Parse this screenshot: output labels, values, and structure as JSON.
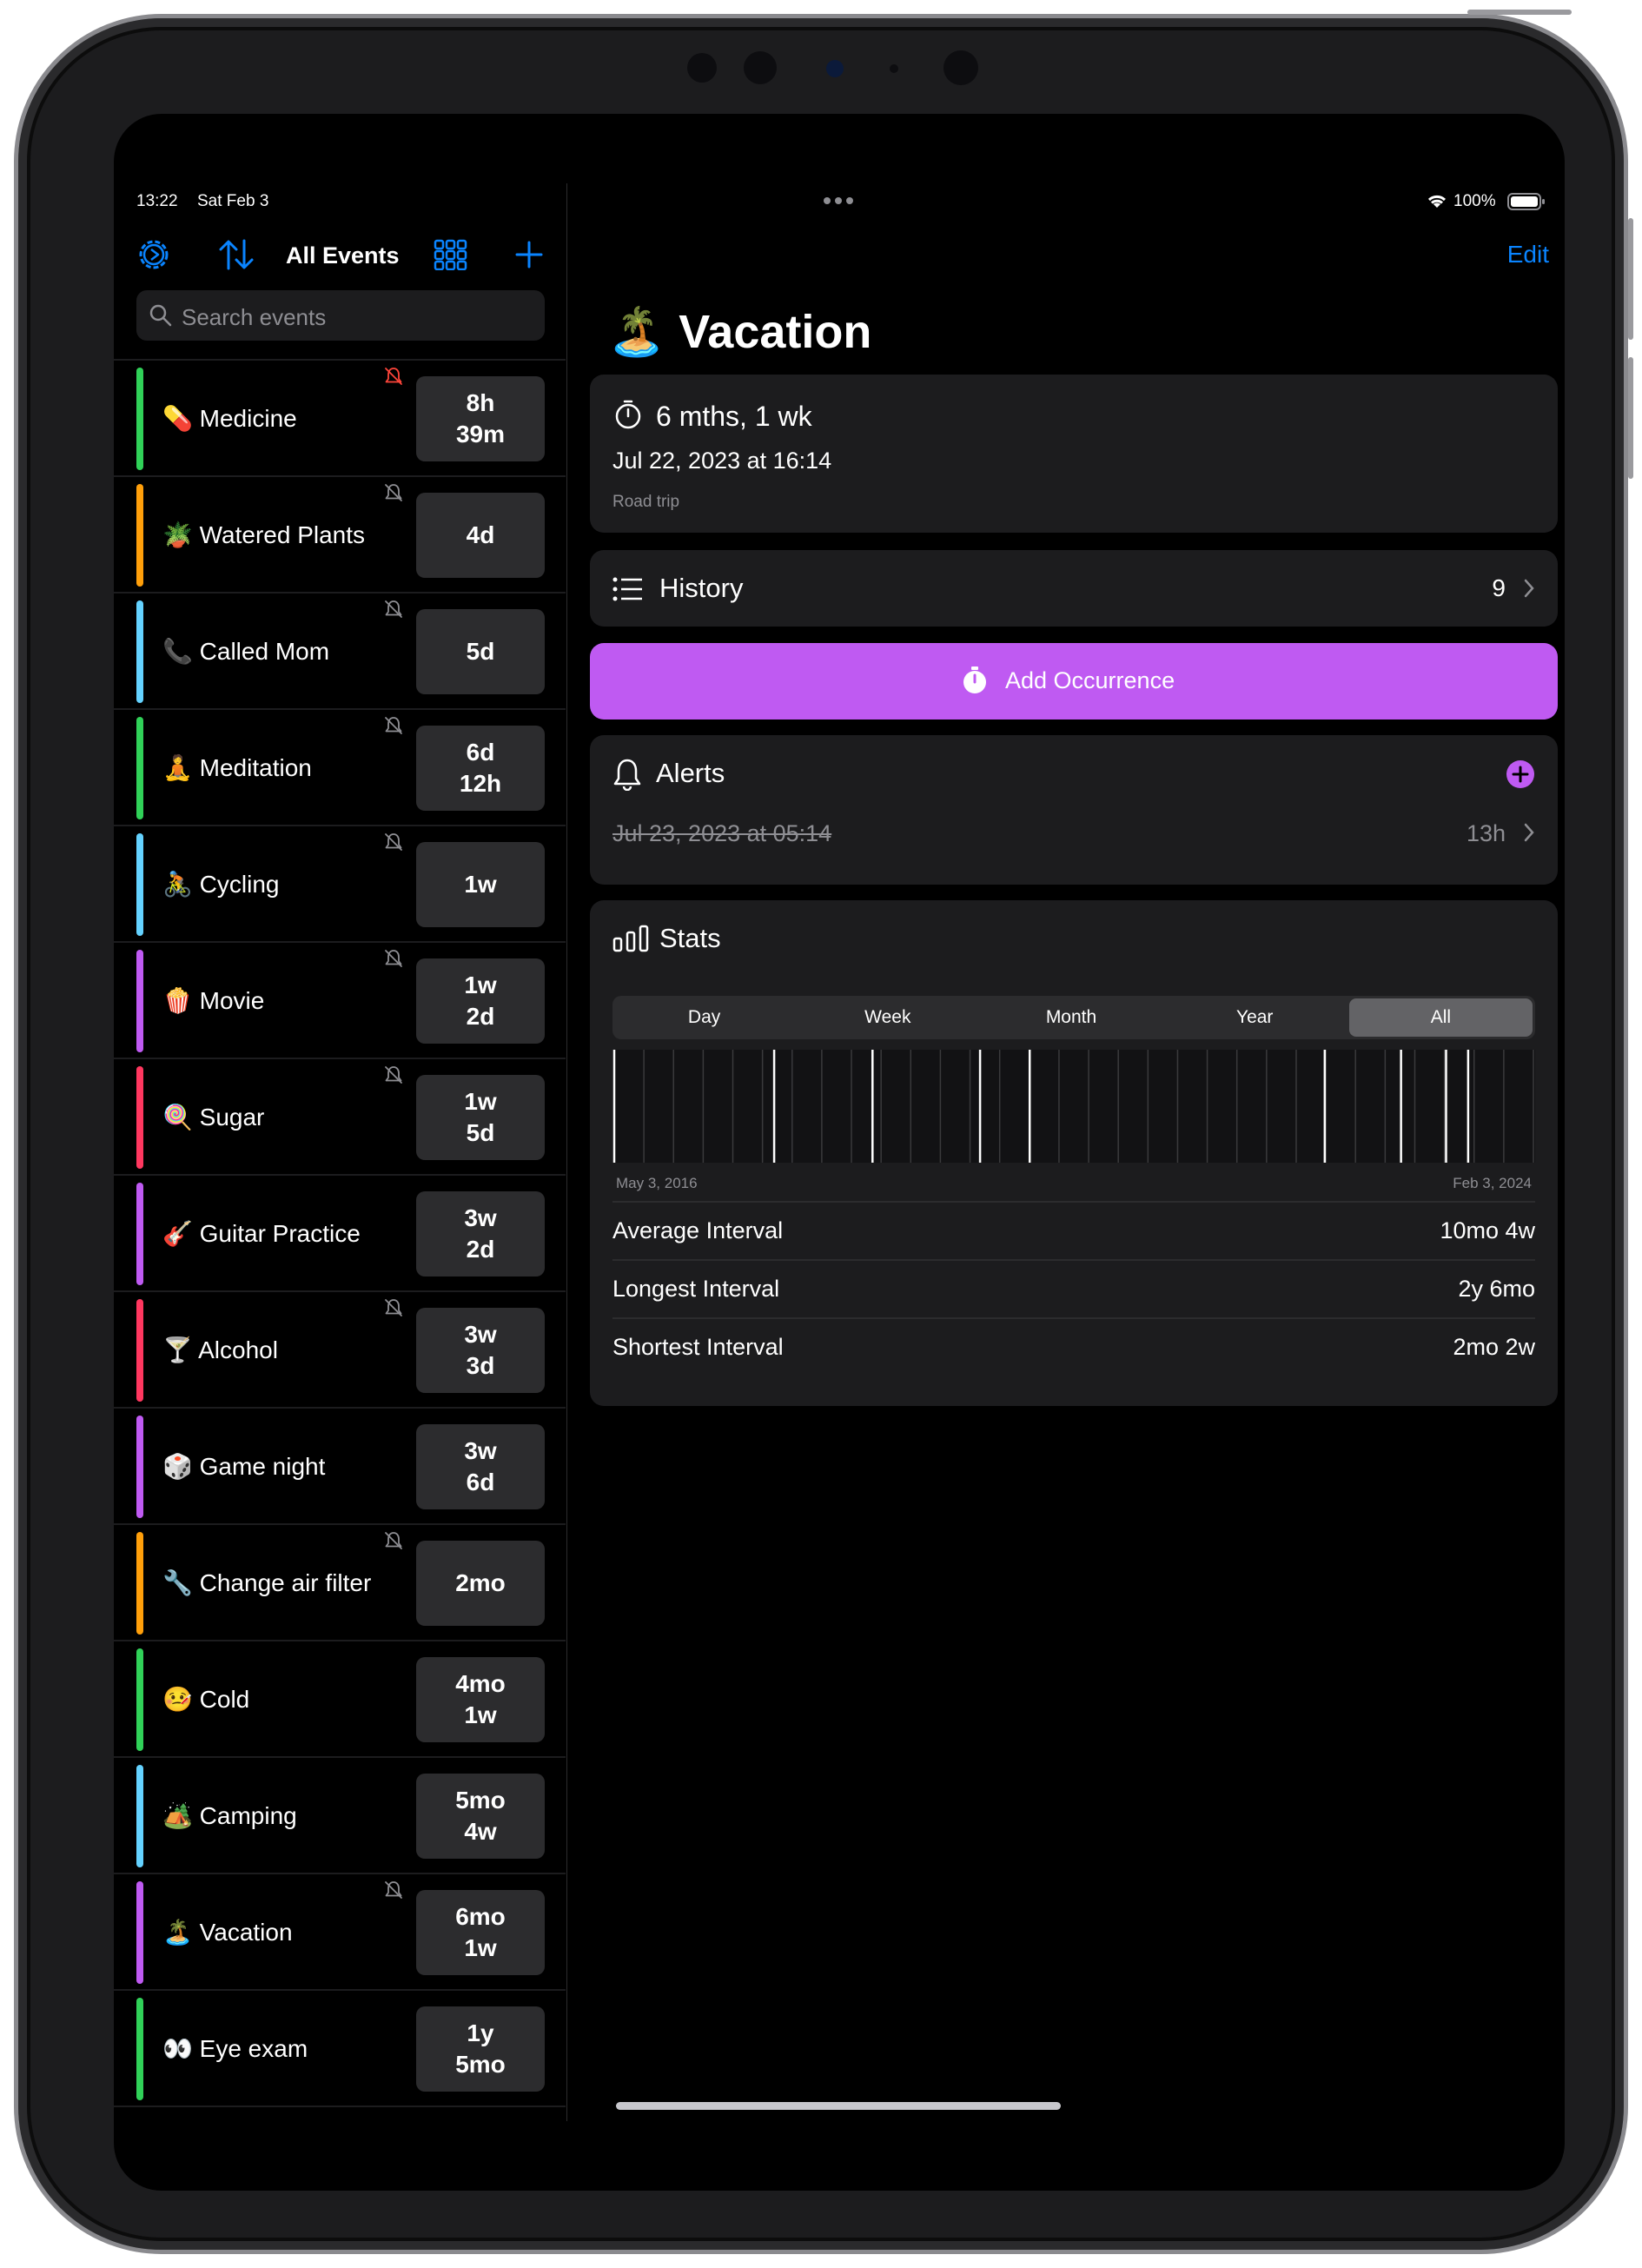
{
  "status_bar": {
    "time": "13:22",
    "date": "Sat Feb 3",
    "battery": "100%"
  },
  "sidebar": {
    "title": "All Events",
    "search_placeholder": "Search events",
    "events": [
      {
        "emoji": "💊",
        "name": "Medicine",
        "badge": "8h\n39m",
        "color": "#30d158",
        "muted": true,
        "mute_color": "#ff453a"
      },
      {
        "emoji": "🪴",
        "name": "Watered Plants",
        "badge": "4d",
        "color": "#ff9f0a",
        "muted": true,
        "mute_color": "#8e8e93"
      },
      {
        "emoji": "📞",
        "name": "Called Mom",
        "badge": "5d",
        "color": "#64d2ff",
        "muted": true,
        "mute_color": "#8e8e93"
      },
      {
        "emoji": "🧘",
        "name": "Meditation",
        "badge": "6d\n12h",
        "color": "#30d158",
        "muted": true,
        "mute_color": "#8e8e93"
      },
      {
        "emoji": "🚴",
        "name": "Cycling",
        "badge": "1w",
        "color": "#64d2ff",
        "muted": true,
        "mute_color": "#8e8e93"
      },
      {
        "emoji": "🍿",
        "name": "Movie",
        "badge": "1w\n2d",
        "color": "#bf5af2",
        "muted": true,
        "mute_color": "#8e8e93"
      },
      {
        "emoji": "🍭",
        "name": "Sugar",
        "badge": "1w\n5d",
        "color": "#ff375f",
        "muted": true,
        "mute_color": "#8e8e93"
      },
      {
        "emoji": "🎸",
        "name": "Guitar Practice",
        "badge": "3w\n2d",
        "color": "#bf5af2",
        "muted": false,
        "mute_color": "#8e8e93"
      },
      {
        "emoji": "🍸",
        "name": "Alcohol",
        "badge": "3w\n3d",
        "color": "#ff375f",
        "muted": true,
        "mute_color": "#8e8e93"
      },
      {
        "emoji": "🎲",
        "name": "Game night",
        "badge": "3w\n6d",
        "color": "#bf5af2",
        "muted": false,
        "mute_color": "#8e8e93"
      },
      {
        "emoji": "🔧",
        "name": "Change air filter",
        "badge": "2mo",
        "color": "#ff9f0a",
        "muted": true,
        "mute_color": "#8e8e93"
      },
      {
        "emoji": "🤒",
        "name": "Cold",
        "badge": "4mo\n1w",
        "color": "#30d158",
        "muted": false,
        "mute_color": "#8e8e93"
      },
      {
        "emoji": "🏕️",
        "name": "Camping",
        "badge": "5mo\n4w",
        "color": "#64d2ff",
        "muted": false,
        "mute_color": "#8e8e93"
      },
      {
        "emoji": "🏝️",
        "name": "Vacation",
        "badge": "6mo\n1w",
        "color": "#bf5af2",
        "muted": true,
        "mute_color": "#8e8e93"
      },
      {
        "emoji": "👀",
        "name": "Eye exam",
        "badge": "1y\n5mo",
        "color": "#30d158",
        "muted": false,
        "mute_color": "#8e8e93"
      }
    ]
  },
  "detail": {
    "edit_label": "Edit",
    "title_emoji": "🏝️",
    "title": "Vacation",
    "summary": {
      "elapsed": "6 mths, 1 wk",
      "last_date": "Jul 22, 2023 at 16:14",
      "note": "Road trip"
    },
    "history": {
      "label": "History",
      "count": "9"
    },
    "add_occurrence_label": "Add Occurrence",
    "alerts": {
      "label": "Alerts",
      "alert_date": "Jul 23, 2023 at 05:14",
      "alert_offset": "13h"
    },
    "stats": {
      "label": "Stats",
      "segments": [
        "Day",
        "Week",
        "Month",
        "Year",
        "All"
      ],
      "active_segment": "All",
      "timeline_start": "May 3, 2016",
      "timeline_end": "Feb 3, 2024",
      "occurrence_positions": [
        0.0,
        0.174,
        0.281,
        0.398,
        0.452,
        0.773,
        0.856,
        0.905,
        0.929
      ],
      "rows": [
        {
          "label": "Average Interval",
          "value": "10mo 4w"
        },
        {
          "label": "Longest Interval",
          "value": "2y 6mo"
        },
        {
          "label": "Shortest Interval",
          "value": "2mo 2w"
        }
      ]
    }
  },
  "colors": {
    "accent": "#0a84ff",
    "purple": "#bf5af2",
    "card": "#1c1c1e"
  }
}
